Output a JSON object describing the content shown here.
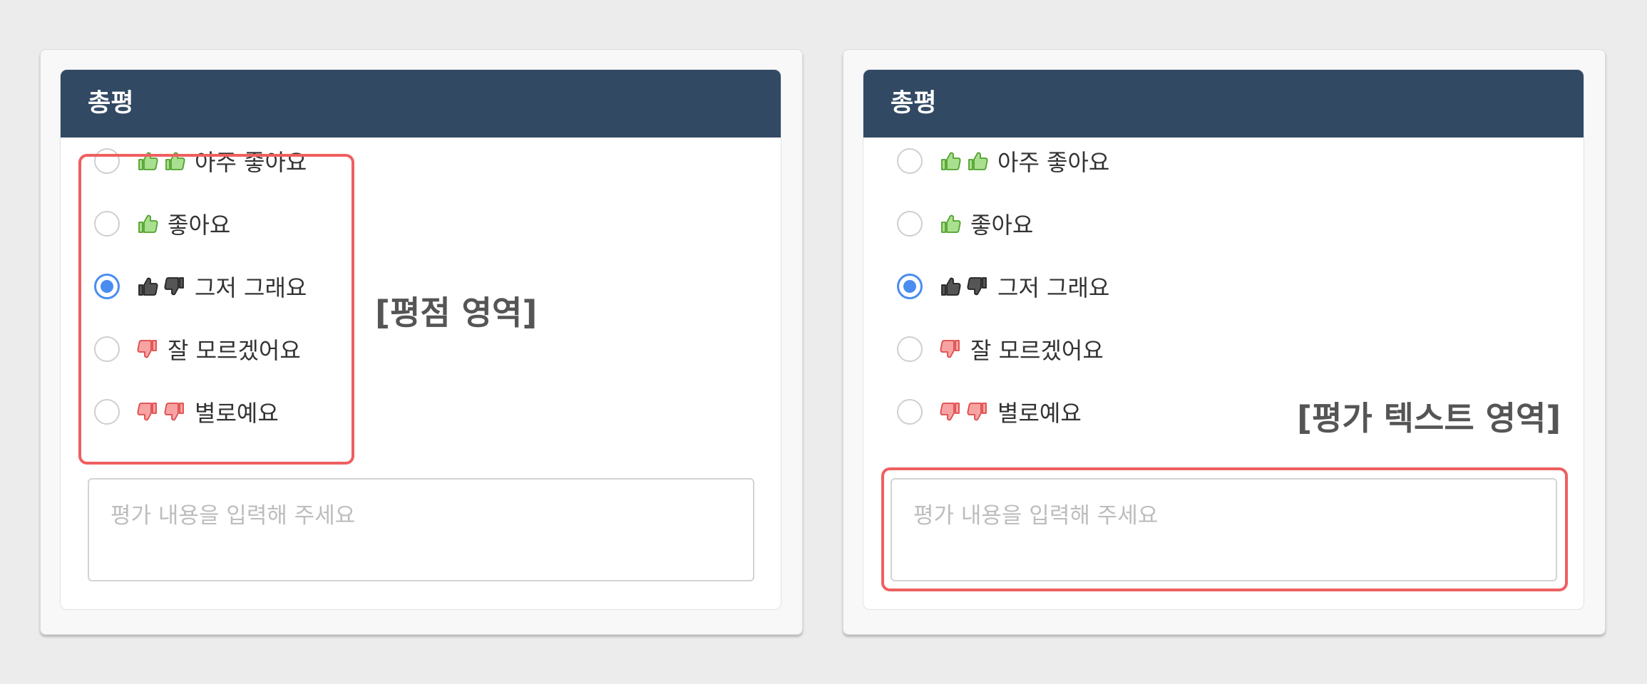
{
  "panels": [
    {
      "header_title": "총평",
      "options": [
        {
          "label": "아주 좋아요",
          "icons": [
            "thumbs-up-icon",
            "thumbs-up-icon"
          ],
          "selected": false
        },
        {
          "label": "좋아요",
          "icons": [
            "thumbs-up-icon"
          ],
          "selected": false
        },
        {
          "label": "그저 그래요",
          "icons": [
            "thumbs-up-icon",
            "thumbs-down-icon"
          ],
          "selected": true
        },
        {
          "label": "잘 모르겠어요",
          "icons": [
            "thumbs-down-icon"
          ],
          "selected": false
        },
        {
          "label": "별로예요",
          "icons": [
            "thumbs-down-icon",
            "thumbs-down-icon"
          ],
          "selected": false
        }
      ],
      "textarea_placeholder": "평가 내용을 입력해 주세요",
      "annotation": "[평점 영역]"
    },
    {
      "header_title": "총평",
      "options": [
        {
          "label": "아주 좋아요",
          "icons": [
            "thumbs-up-icon",
            "thumbs-up-icon"
          ],
          "selected": false
        },
        {
          "label": "좋아요",
          "icons": [
            "thumbs-up-icon"
          ],
          "selected": false
        },
        {
          "label": "그저 그래요",
          "icons": [
            "thumbs-up-icon",
            "thumbs-down-icon"
          ],
          "selected": true
        },
        {
          "label": "잘 모르겠어요",
          "icons": [
            "thumbs-down-icon"
          ],
          "selected": false
        },
        {
          "label": "별로예요",
          "icons": [
            "thumbs-down-icon",
            "thumbs-down-icon"
          ],
          "selected": false
        }
      ],
      "textarea_placeholder": "평가 내용을 입력해 주세요",
      "annotation": "[평가 텍스트 영역]"
    }
  ],
  "colors": {
    "header_bg": "#324963",
    "highlight": "#ef5f60",
    "radio_selected": "#4a8cf0",
    "thumb_positive": "#6cc24a",
    "thumb_negative": "#ef5f60",
    "thumb_neutral": "#333333"
  }
}
